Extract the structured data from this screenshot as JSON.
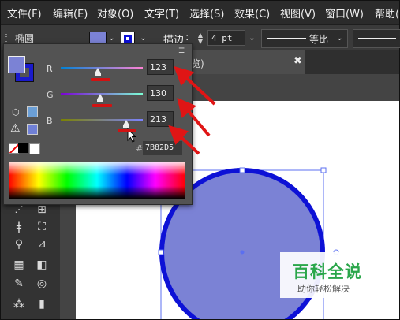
{
  "menu": [
    "文件(F)",
    "编辑(E)",
    "对象(O)",
    "文字(T)",
    "选择(S)",
    "效果(C)",
    "视图(V)",
    "窗口(W)",
    "帮助("
  ],
  "control_bar": {
    "object_type": "椭圆",
    "stroke_label": "描边",
    "stroke_weight": "4 pt",
    "profile_label": "等比"
  },
  "document_tab": {
    "title_fragment": "览)",
    "close_glyph": "✖"
  },
  "color_panel": {
    "channels": [
      {
        "label": "R",
        "value": "123",
        "level": 0.48
      },
      {
        "label": "G",
        "value": "130",
        "level": 0.51
      },
      {
        "label": "B",
        "value": "213",
        "level": 0.84
      }
    ],
    "hex_label": "#",
    "hex_value": "7B82D5",
    "fill_color": "#7b82d5",
    "stroke_color": "#1a1acc"
  },
  "artwork": {
    "shape": "ellipse",
    "fill_color": "#7b82d5",
    "stroke_color": "#0d11d6"
  },
  "watermark": {
    "title": "百科全说",
    "subtitle": "助你轻松解决"
  },
  "annotation_color": "#d11212"
}
